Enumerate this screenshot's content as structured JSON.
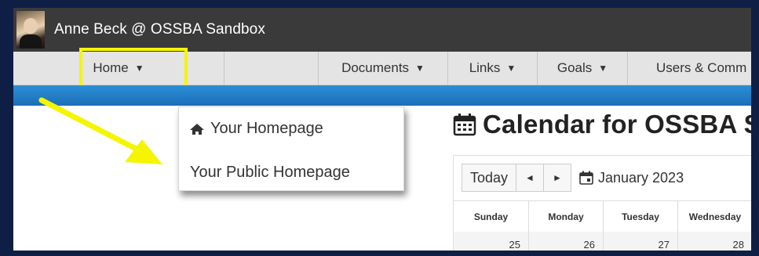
{
  "header": {
    "site_title": "Anne Beck @ OSSBA Sandbox"
  },
  "nav": {
    "home": "Home",
    "documents": "Documents",
    "links": "Links",
    "goals": "Goals",
    "users": "Users & Comm",
    "caret": "▼"
  },
  "home_menu": {
    "items": [
      "Your Homepage",
      "Your Public Homepage"
    ]
  },
  "calendar": {
    "title": "Calendar for OSSBA S",
    "today_label": "Today",
    "prev_label": "◄",
    "next_label": "►",
    "month_label": "January 2023",
    "days": [
      "Sunday",
      "Monday",
      "Tuesday",
      "Wednesday"
    ],
    "dates": [
      "25",
      "26",
      "27",
      "28"
    ]
  },
  "colors": {
    "highlight": "#f5f500",
    "topbar": "#3a3a3a",
    "blue_strip": "#1a6fb8"
  }
}
